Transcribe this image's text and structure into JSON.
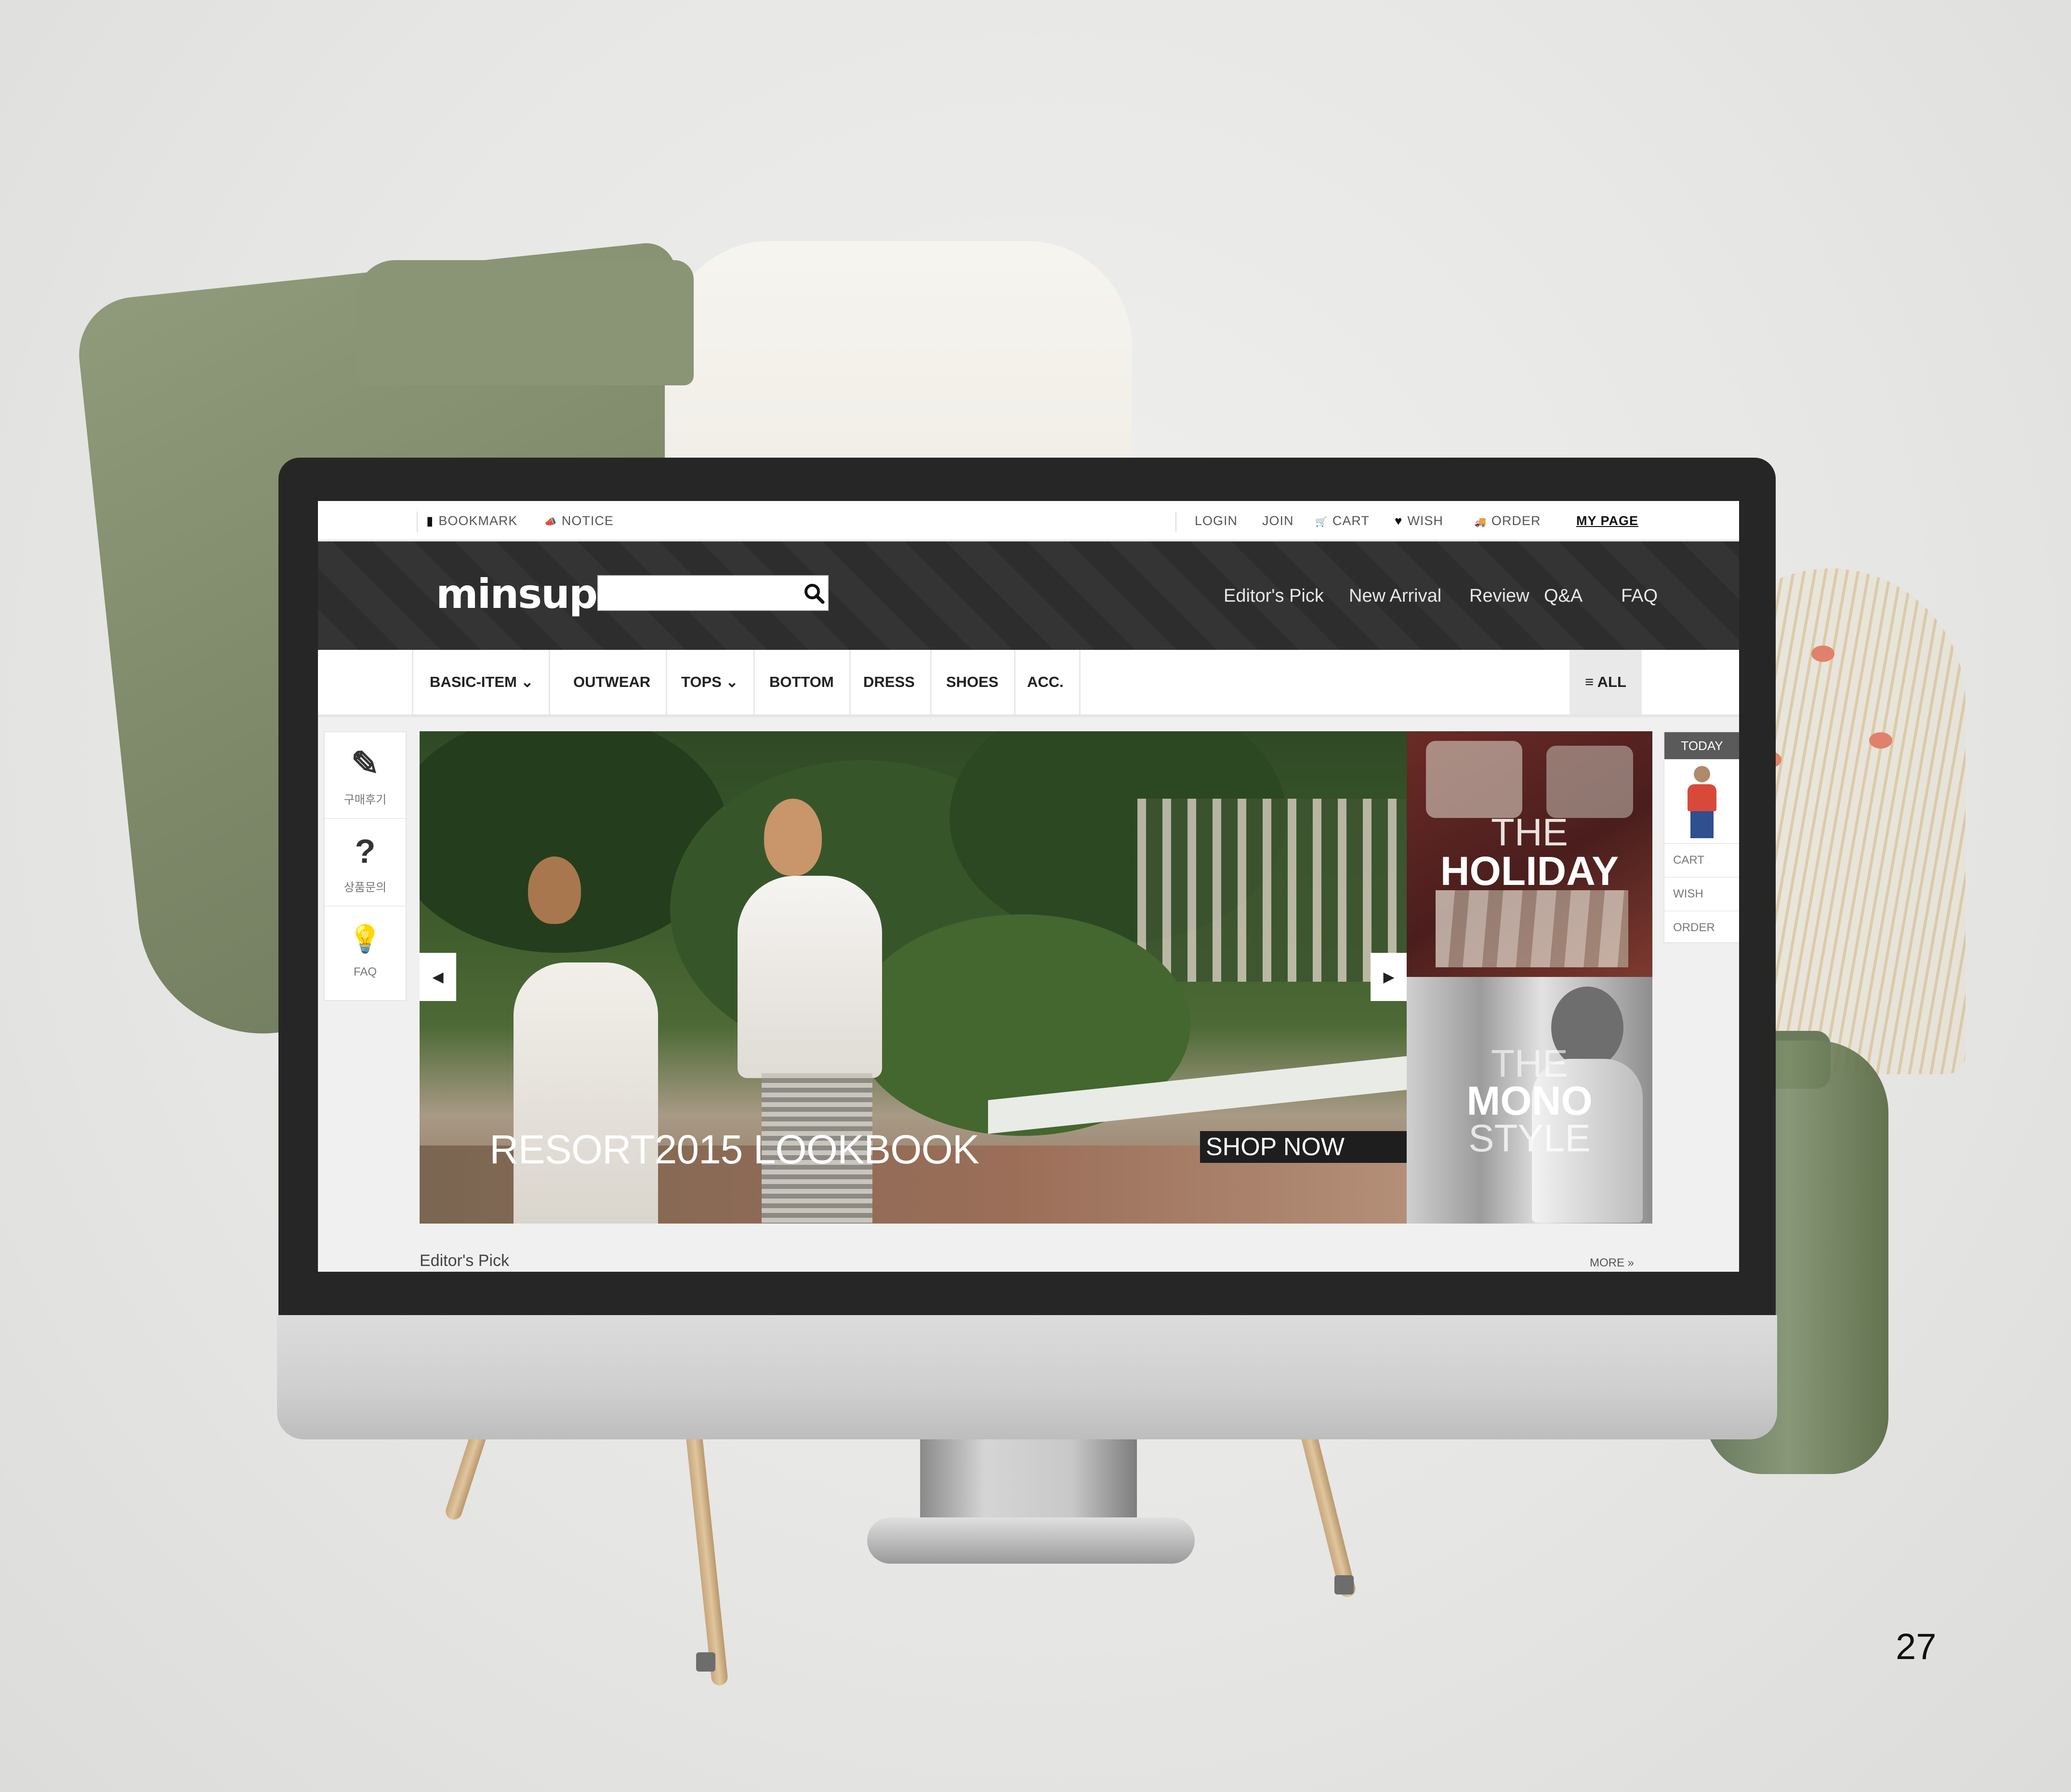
{
  "page_number": "27",
  "site": {
    "topbar": {
      "left": [
        {
          "label": "BOOKMARK",
          "icon": "bookmark-icon",
          "glyph": "▮"
        },
        {
          "label": "NOTICE",
          "icon": "megaphone-icon",
          "glyph": "📣"
        }
      ],
      "right": [
        {
          "label": "LOGIN"
        },
        {
          "label": "JOIN"
        },
        {
          "label": "CART",
          "icon": "cart-icon",
          "glyph": "🛒"
        },
        {
          "label": "WISH",
          "icon": "heart-icon",
          "glyph": "♥"
        },
        {
          "label": "ORDER",
          "icon": "truck-icon",
          "glyph": "🚚"
        },
        {
          "label": "MY PAGE"
        }
      ]
    },
    "header": {
      "logo": "minsup",
      "search_placeholder": "",
      "nav": [
        "Editor's Pick",
        "New Arrival",
        "Review",
        "Q&A",
        "FAQ"
      ]
    },
    "categories": [
      "BASIC-ITEM ⌄",
      "OUTWEAR",
      "TOPS ⌄",
      "BOTTOM",
      "DRESS",
      "SHOES",
      "ACC."
    ],
    "all_button": "≡ ALL",
    "left_tools": [
      {
        "label": "구매후기",
        "icon": "pencil-icon",
        "glyph": "✎"
      },
      {
        "label": "상품문의",
        "icon": "question-icon",
        "glyph": "?"
      },
      {
        "label": "FAQ",
        "icon": "lightbulb-icon",
        "glyph": "💡"
      }
    ],
    "hero": {
      "title": "RESORT2015 LOOKBOOK",
      "cta": "SHOP NOW",
      "prev_glyph": "◀",
      "next_glyph": "▶"
    },
    "banners": {
      "holiday": {
        "line1": "THE",
        "line2": "HOLIDAY"
      },
      "mono": {
        "line1": "THE",
        "line2": "MONO",
        "line3": "STYLE"
      }
    },
    "today_panel": {
      "title": "TODAY",
      "items": [
        "CART",
        "WISH",
        "ORDER"
      ]
    },
    "section": {
      "title": "Editor's Pick",
      "more": "MORE »"
    }
  },
  "colors": {
    "header_bg": "#2d2d2d",
    "accent_dark": "#1e1e1e",
    "throw_green": "#7c8868"
  }
}
